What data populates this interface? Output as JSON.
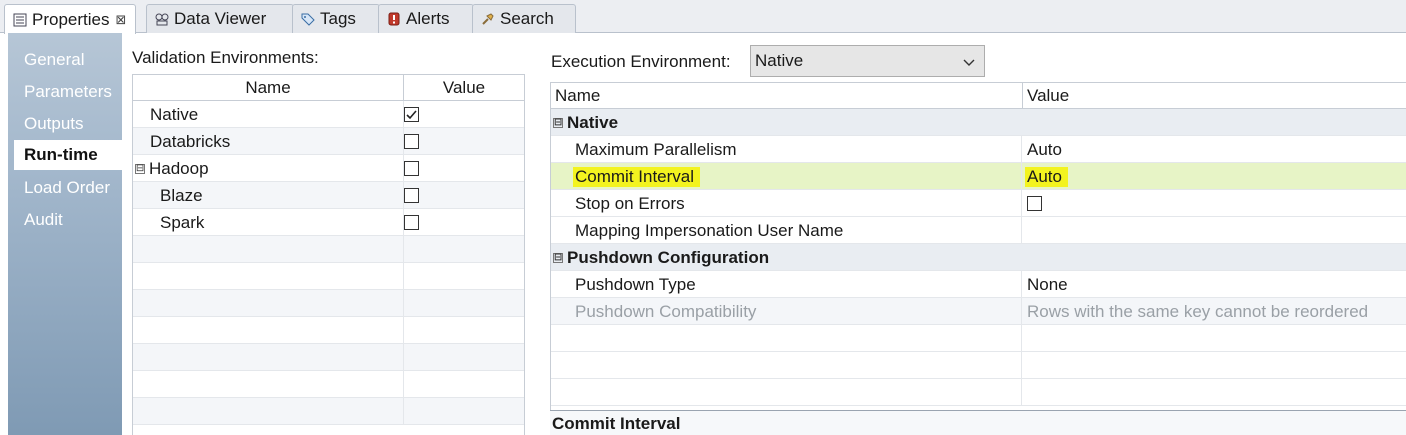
{
  "tabs": [
    {
      "label": "Properties",
      "icon": "properties-icon",
      "active": true,
      "close": "⊠"
    },
    {
      "label": "Data Viewer",
      "icon": "data-viewer-icon"
    },
    {
      "label": "Tags",
      "icon": "tag-icon"
    },
    {
      "label": "Alerts",
      "icon": "alert-icon"
    },
    {
      "label": "Search",
      "icon": "search-icon"
    }
  ],
  "sidebar": {
    "items": [
      {
        "label": "General"
      },
      {
        "label": "Parameters"
      },
      {
        "label": "Outputs"
      },
      {
        "label": "Run-time",
        "active": true
      },
      {
        "label": "Load Order"
      },
      {
        "label": "Audit"
      }
    ]
  },
  "validation": {
    "title": "Validation Environments:",
    "columns": {
      "name": "Name",
      "value": "Value"
    },
    "rows": [
      {
        "name": "Native",
        "checked": true
      },
      {
        "name": "Databricks",
        "checked": false
      },
      {
        "name": "Hadoop",
        "checked": false,
        "expander": "⊟"
      },
      {
        "name": "Blaze",
        "checked": false
      },
      {
        "name": "Spark",
        "checked": false
      }
    ]
  },
  "execution": {
    "label": "Execution Environment:",
    "selected": "Native",
    "columns": {
      "name": "Name",
      "value": "Value"
    },
    "groups": {
      "native": {
        "label": "Native",
        "expander": "⊟"
      },
      "pushdown": {
        "label": "Pushdown Configuration",
        "expander": "⊟"
      }
    },
    "rows": {
      "max_parallelism": {
        "name": "Maximum Parallelism",
        "value": "Auto"
      },
      "commit_interval": {
        "name": "Commit Interval",
        "value": "Auto"
      },
      "stop_on_errors": {
        "name": "Stop on Errors",
        "checked": false
      },
      "impersonation": {
        "name": "Mapping Impersonation User Name",
        "value": ""
      },
      "pushdown_type": {
        "name": "Pushdown Type",
        "value": "None"
      },
      "pushdown_compat": {
        "name": "Pushdown Compatibility",
        "value": "Rows with the same key cannot be reordered"
      }
    }
  },
  "detail": {
    "title": "Commit Interval"
  },
  "colors": {
    "highlight_marker": "#f3f31f",
    "highlight_row": "#e7f4c6",
    "nav_gradient_top": "#b6c6d6",
    "nav_gradient_bottom": "#7f9ab4"
  }
}
